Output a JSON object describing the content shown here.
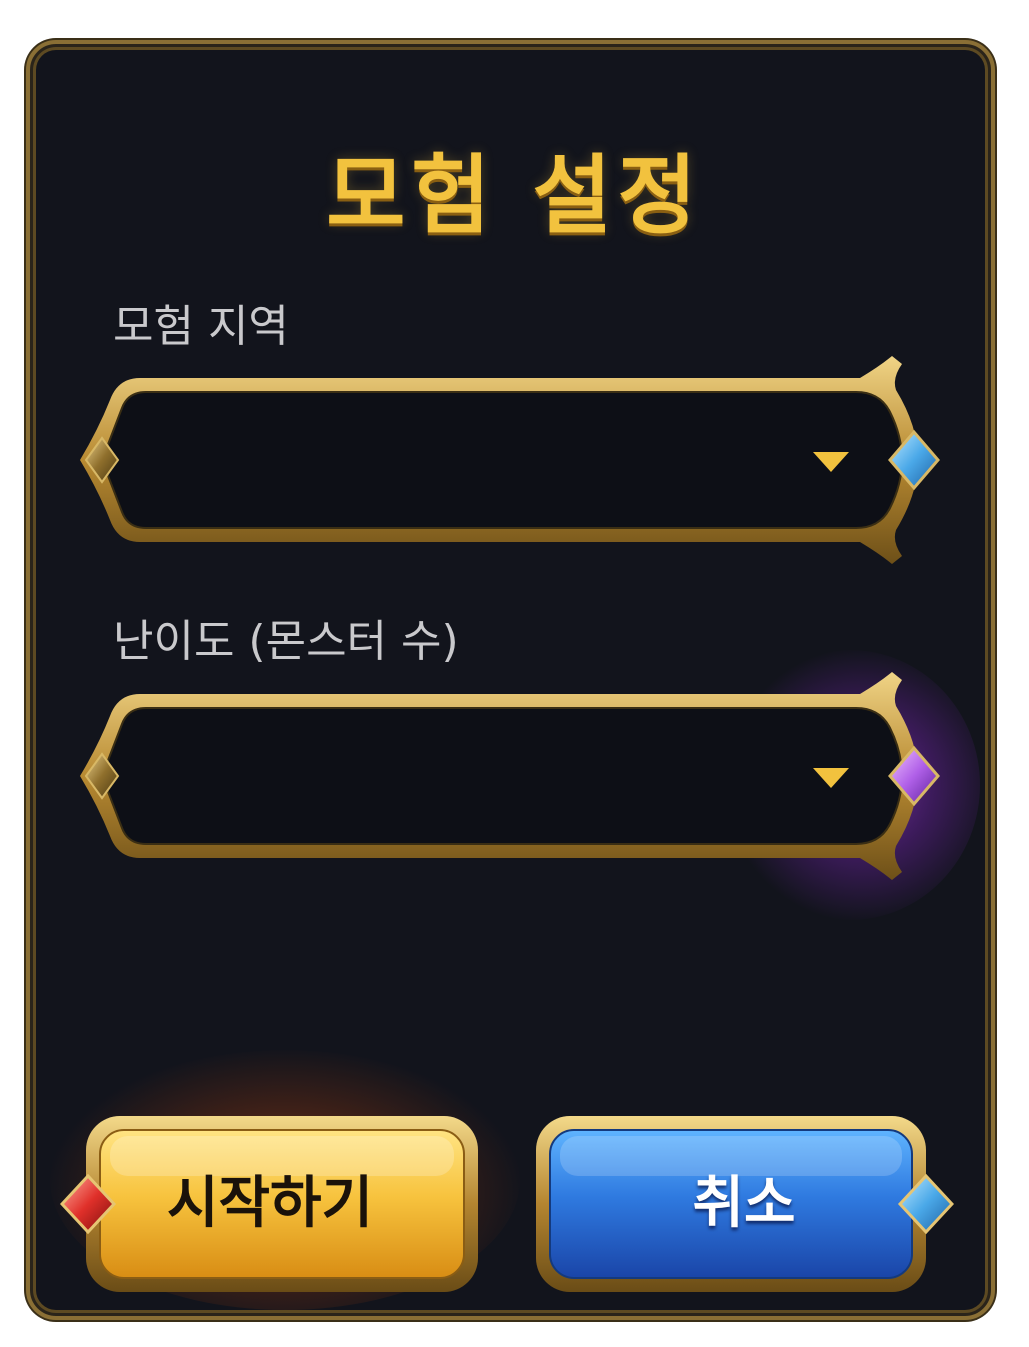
{
  "dialog": {
    "title": "모험 설정"
  },
  "fields": {
    "region": {
      "label": "모험 지역",
      "value": "",
      "icon": "chevron-down-icon",
      "gem_color": "#5fb8f0"
    },
    "difficulty": {
      "label": "난이도 (몬스터 수)",
      "value": "",
      "icon": "chevron-down-icon",
      "gem_color": "#b060e8"
    }
  },
  "buttons": {
    "start_label": "시작하기",
    "cancel_label": "취소"
  },
  "colors": {
    "title": "#f2c23e",
    "frame_gold": "#c9a24a",
    "panel_bg": "#12141c",
    "start_button": "#f5b931",
    "cancel_button": "#2f7ae0"
  }
}
